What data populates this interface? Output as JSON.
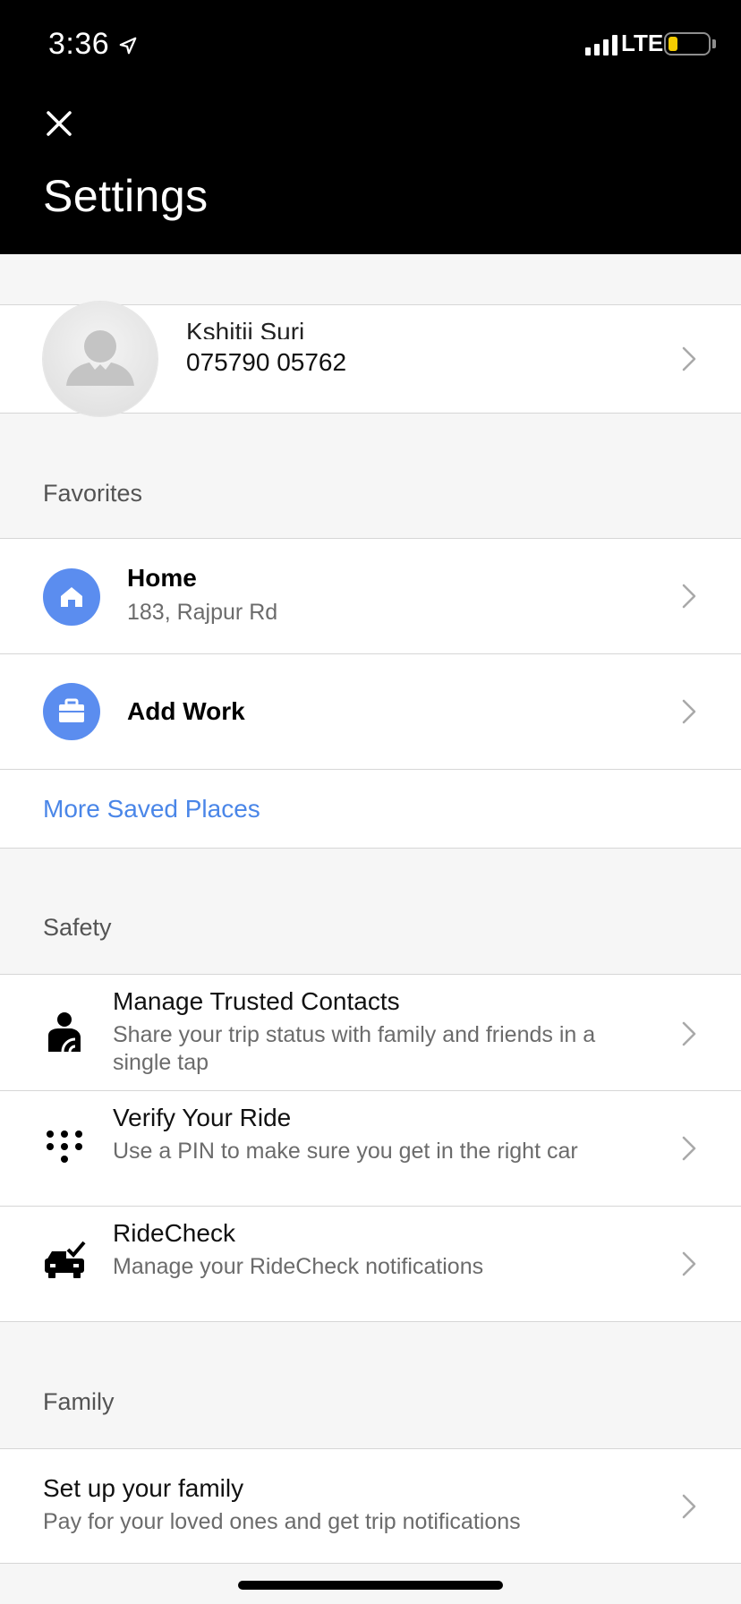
{
  "status_bar": {
    "time": "3:36",
    "network": "LTE"
  },
  "header": {
    "title": "Settings"
  },
  "profile": {
    "name": "Kshitij Suri",
    "phone": "075790 05762"
  },
  "favorites": {
    "section_title": "Favorites",
    "items": [
      {
        "title": "Home",
        "subtitle": "183, Rajpur Rd",
        "icon": "home-icon"
      },
      {
        "title": "Add Work",
        "icon": "briefcase-icon"
      }
    ],
    "more_link": "More Saved Places"
  },
  "safety": {
    "section_title": "Safety",
    "items": [
      {
        "title": "Manage Trusted Contacts",
        "subtitle": "Share your trip status with family and friends in a single tap",
        "icon": "trusted-contacts-icon"
      },
      {
        "title": "Verify Your Ride",
        "subtitle": "Use a PIN to make sure you get in the right car",
        "icon": "pin-keypad-icon"
      },
      {
        "title": "RideCheck",
        "subtitle": "Manage your RideCheck notifications",
        "icon": "car-check-icon"
      }
    ]
  },
  "family": {
    "section_title": "Family",
    "items": [
      {
        "title": "Set up your family",
        "subtitle": "Pay for your loved ones and get trip notifications"
      }
    ]
  },
  "colors": {
    "accent_blue": "#5b8def",
    "link_blue": "#4a86e8",
    "header_bg": "#000000",
    "battery": "#f5cc00"
  }
}
